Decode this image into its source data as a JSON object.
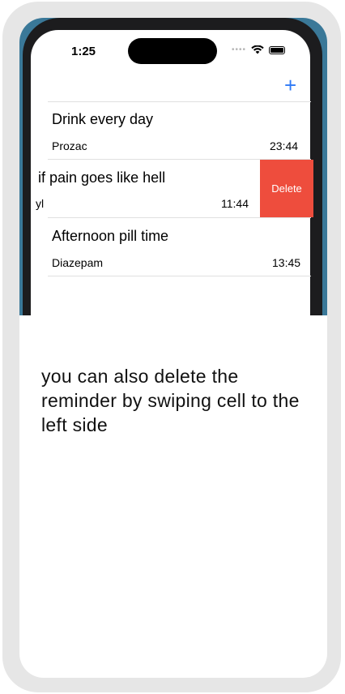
{
  "status_bar": {
    "time": "1:25",
    "signal_dots": "••••"
  },
  "toolbar": {
    "add_label": "+"
  },
  "reminders": [
    {
      "title": "Drink every day",
      "medicine": "Prozac",
      "time": "23:44"
    },
    {
      "title": "if pain goes like hell",
      "medicine": "yl",
      "time": "11:44"
    },
    {
      "title": "Afternoon pill time",
      "medicine": "Diazepam",
      "time": "13:45"
    }
  ],
  "swipe_action": {
    "label": "Delete",
    "color": "#ee4d3d"
  },
  "caption": "you can also delete the reminder by swiping cell to the left side",
  "colors": {
    "accent": "#2f7af6",
    "preview_background": "#3a7898"
  }
}
